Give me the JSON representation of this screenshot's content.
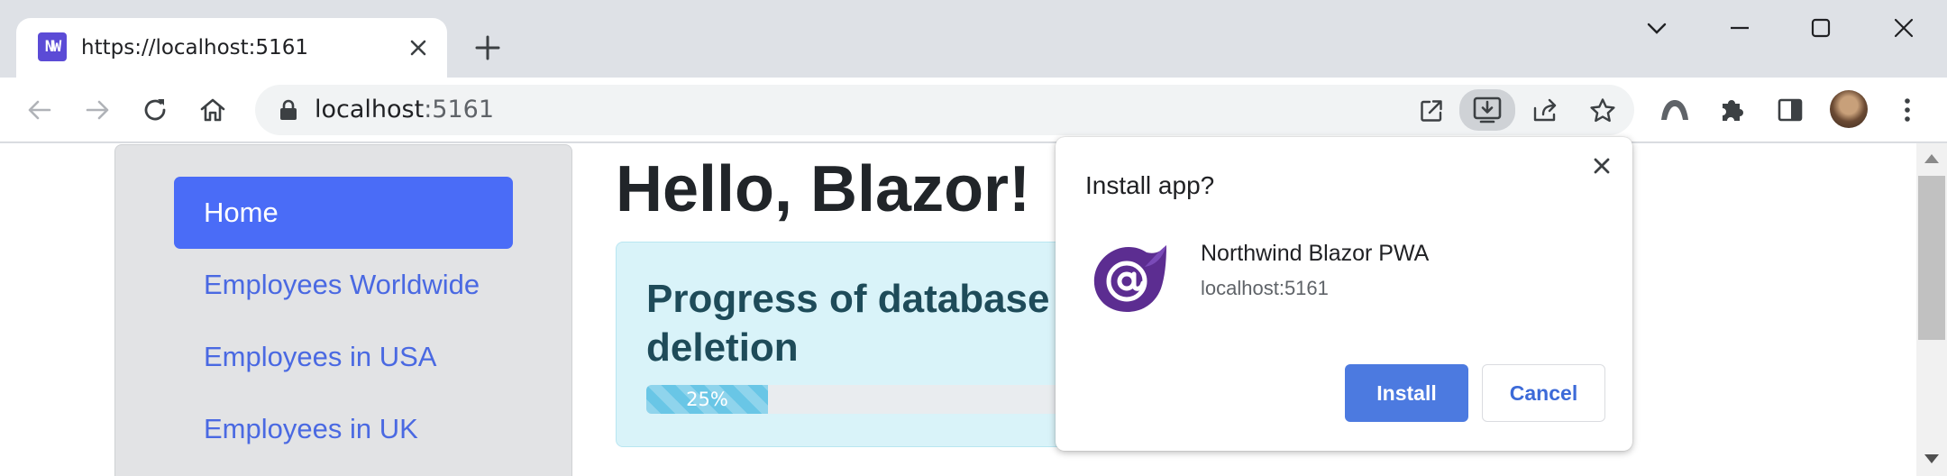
{
  "tab": {
    "title": "https://localhost:5161",
    "favicon_text": "NW"
  },
  "omnibox": {
    "host": "localhost",
    "port": ":5161"
  },
  "sidebar": {
    "items": [
      {
        "label": "Home",
        "active": true
      },
      {
        "label": "Employees Worldwide",
        "active": false
      },
      {
        "label": "Employees in USA",
        "active": false
      },
      {
        "label": "Employees in UK",
        "active": false
      }
    ]
  },
  "main": {
    "title": "Hello, Blazor!",
    "alert_heading": "Progress of database deletion",
    "progress": {
      "value": 25,
      "label": "25%"
    }
  },
  "install_dialog": {
    "title": "Install app?",
    "app_name": "Northwind Blazor PWA",
    "app_origin": "localhost:5161",
    "install_label": "Install",
    "cancel_label": "Cancel"
  },
  "icons": {
    "toolbar": [
      "back-icon",
      "forward-icon",
      "reload-icon",
      "home-icon"
    ],
    "omnibox": [
      "lock-icon",
      "open-in-app-icon",
      "install-app-icon",
      "share-icon",
      "bookmark-star-icon"
    ],
    "extensions": [
      "extension-arc-icon",
      "extensions-puzzle-icon",
      "side-panel-icon",
      "profile-avatar",
      "menu-kebab-icon"
    ]
  },
  "colors": {
    "accent": "#4a6cf7",
    "install_button": "#4c7ae0",
    "alert_bg": "#d9f3f9",
    "progress": "#69c6e6",
    "blazor_purple": "#5c2d91"
  }
}
